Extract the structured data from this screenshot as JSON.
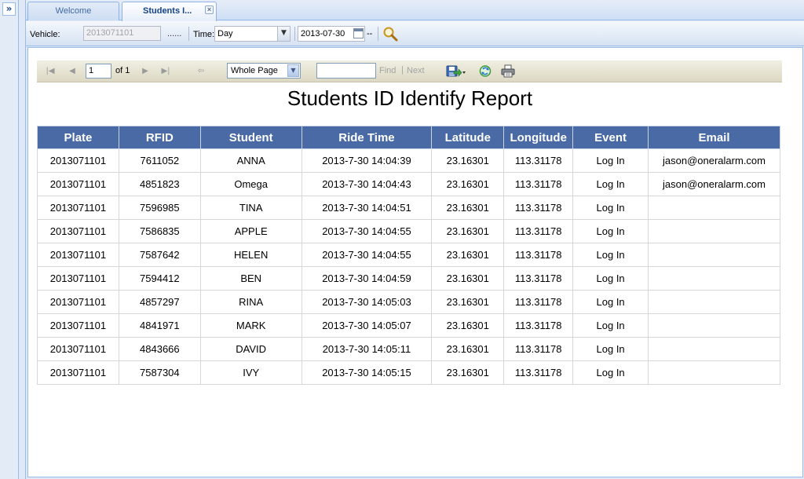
{
  "tabs": [
    {
      "label": "Welcome"
    },
    {
      "label": "Students I..."
    }
  ],
  "filters": {
    "vehicle_label": "Vehicle:",
    "vehicle_value": "2013071101",
    "ellipsis": "......",
    "time_label": "Time:",
    "time_value": "Day",
    "date_value": "2013-07-30",
    "date_suffix": "--"
  },
  "viewer": {
    "page_value": "1",
    "page_of": "of 1",
    "zoom_value": "Whole Page",
    "find_label": "Find",
    "separator": "|",
    "next_label": "Next"
  },
  "report": {
    "title": "Students ID Identify Report",
    "columns": [
      "Plate",
      "RFID",
      "Student",
      "Ride Time",
      "Latitude",
      "Longitude",
      "Event",
      "Email"
    ],
    "rows": [
      [
        "2013071101",
        "7611052",
        "ANNA",
        "2013-7-30 14:04:39",
        "23.16301",
        "113.31178",
        "Log In",
        "jason@oneralarm.com"
      ],
      [
        "2013071101",
        "4851823",
        "Omega",
        "2013-7-30 14:04:43",
        "23.16301",
        "113.31178",
        "Log In",
        "jason@oneralarm.com"
      ],
      [
        "2013071101",
        "7596985",
        "TINA",
        "2013-7-30 14:04:51",
        "23.16301",
        "113.31178",
        "Log In",
        ""
      ],
      [
        "2013071101",
        "7586835",
        "APPLE",
        "2013-7-30 14:04:55",
        "23.16301",
        "113.31178",
        "Log In",
        ""
      ],
      [
        "2013071101",
        "7587642",
        "HELEN",
        "2013-7-30 14:04:55",
        "23.16301",
        "113.31178",
        "Log In",
        ""
      ],
      [
        "2013071101",
        "7594412",
        "BEN",
        "2013-7-30 14:04:59",
        "23.16301",
        "113.31178",
        "Log In",
        ""
      ],
      [
        "2013071101",
        "4857297",
        "RINA",
        "2013-7-30 14:05:03",
        "23.16301",
        "113.31178",
        "Log In",
        ""
      ],
      [
        "2013071101",
        "4841971",
        "MARK",
        "2013-7-30 14:05:07",
        "23.16301",
        "113.31178",
        "Log In",
        ""
      ],
      [
        "2013071101",
        "4843666",
        "DAVID",
        "2013-7-30 14:05:11",
        "23.16301",
        "113.31178",
        "Log In",
        ""
      ],
      [
        "2013071101",
        "7587304",
        "IVY",
        "2013-7-30 14:05:15",
        "23.16301",
        "113.31178",
        "Log In",
        ""
      ]
    ]
  },
  "icons": {
    "expand": "double-chevron-right-icon",
    "close": "close-icon",
    "calendar": "calendar-icon",
    "search": "magnifier-icon",
    "first": "first-page-icon",
    "prev": "previous-page-icon",
    "next": "next-page-icon",
    "last": "last-page-icon",
    "back": "back-icon",
    "export": "save-export-icon",
    "refresh": "refresh-icon",
    "print": "printer-icon"
  },
  "colors": {
    "header_bg": "#4a6aa5",
    "accent": "#15428b",
    "panel_bg": "#dfe8f6"
  }
}
